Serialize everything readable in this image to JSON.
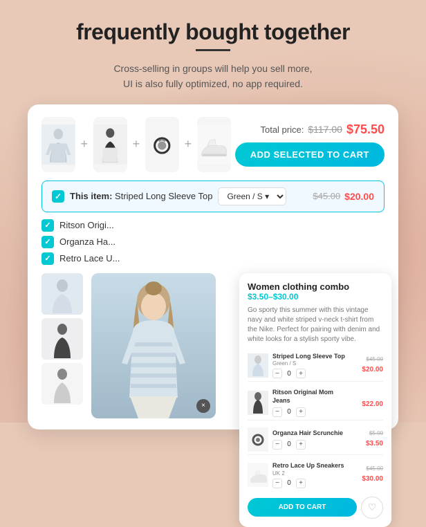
{
  "page": {
    "title": "frequently bought together",
    "subtitle_line1": "Cross-selling in groups will help you sell more,",
    "subtitle_line2": "UI is also fully optimized, no app required."
  },
  "card": {
    "total_label": "Total price:",
    "old_total": "$117.00",
    "new_total": "$75.50",
    "add_to_cart_label": "ADD SELECTED TO CART",
    "selected_item": {
      "prefix": "This item:",
      "name": "Striped Long Sleeve Top",
      "variant": "Green / S",
      "old_price": "$45.00",
      "new_price": "$20.00"
    },
    "list_items": [
      {
        "name": "Ritson Origi..."
      },
      {
        "name": "Organza Ha..."
      },
      {
        "name": "Retro Lace U..."
      }
    ]
  },
  "overlay_card": {
    "title": "Women clothing combo",
    "price_range": "$3.50–$30.00",
    "description": "Go sporty this summer with this vintage navy and white striped v-neck t-shirt from the Nike. Perfect for pairing with denim and white looks for a stylish sporty vibe.",
    "items": [
      {
        "name": "Striped Long Sleeve Top",
        "variant": "Green / S",
        "qty": "0",
        "old_price": "$45.00",
        "new_price": "$20.00"
      },
      {
        "name": "Ritson Original Mom Jeans",
        "variant": "",
        "qty": "0",
        "old_price": "",
        "new_price": "$22.00"
      },
      {
        "name": "Organza Hair Scrunchie",
        "variant": "",
        "qty": "0",
        "old_price": "$5.00",
        "new_price": "$3.50"
      },
      {
        "name": "Retro Lace Up Sneakers",
        "variant": "UK 2",
        "qty": "0",
        "old_price": "$45.00",
        "new_price": "$30.00"
      }
    ],
    "add_to_cart_label": "ADD TO CART",
    "qty_minus": "−",
    "qty_plus": "+"
  },
  "icons": {
    "plus": "+",
    "check": "✓",
    "heart": "♡",
    "close": "×",
    "chevron_down": "▾"
  }
}
